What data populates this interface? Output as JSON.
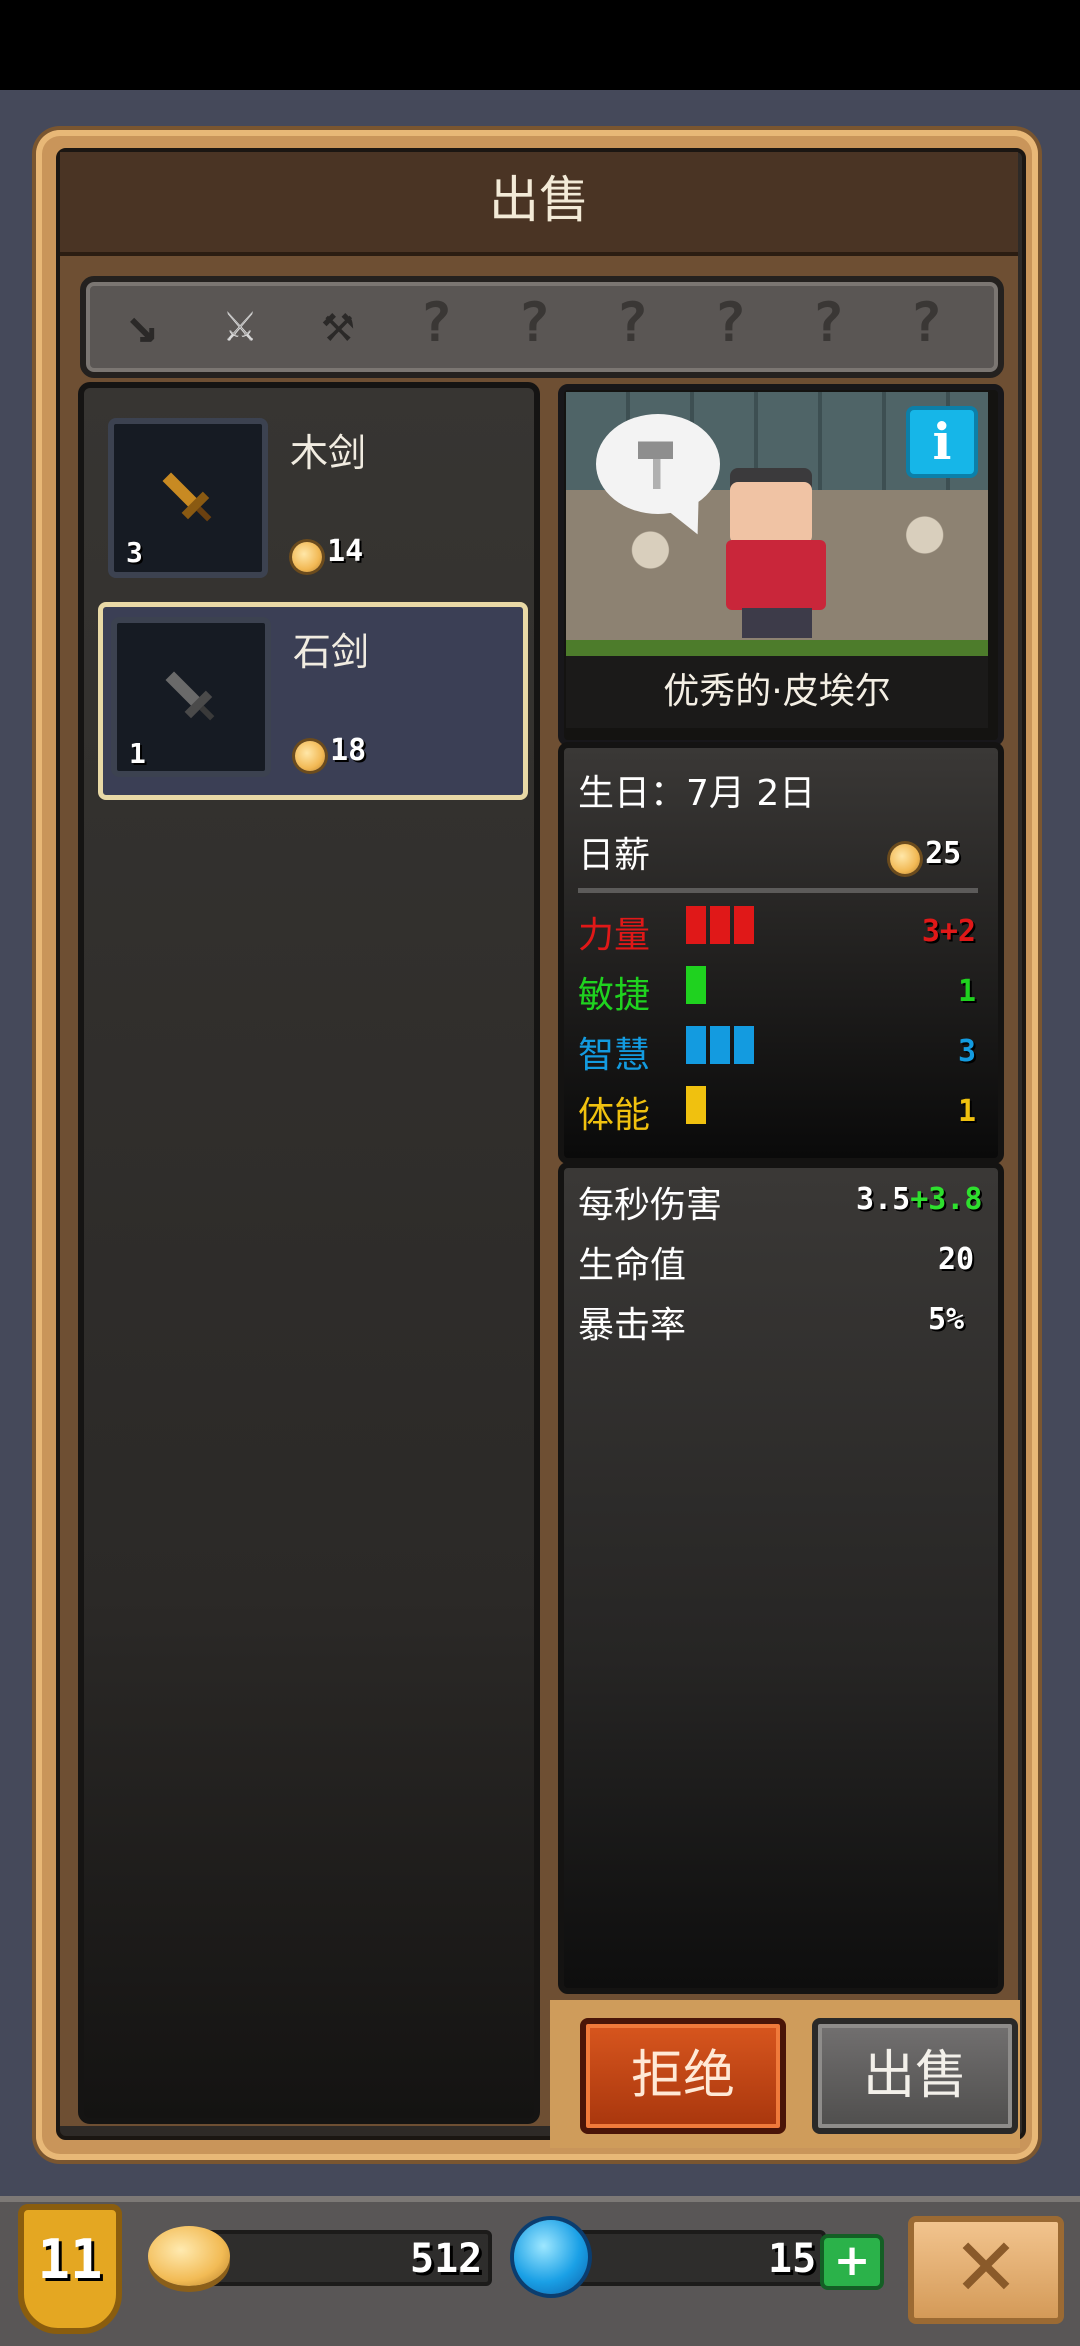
{
  "title": "出售",
  "filter_tabs": [
    {
      "icon": "dagger-icon",
      "glyph": "↘",
      "locked": false
    },
    {
      "icon": "sword-icon",
      "glyph": "⚔",
      "locked": false,
      "selected": true
    },
    {
      "icon": "axe-icon",
      "glyph": "⚒",
      "locked": false
    },
    {
      "icon": "locked-icon",
      "glyph": "?",
      "locked": true
    },
    {
      "icon": "locked-icon",
      "glyph": "?",
      "locked": true
    },
    {
      "icon": "locked-icon",
      "glyph": "?",
      "locked": true
    },
    {
      "icon": "locked-icon",
      "glyph": "?",
      "locked": true
    },
    {
      "icon": "locked-icon",
      "glyph": "?",
      "locked": true
    },
    {
      "icon": "locked-icon",
      "glyph": "?",
      "locked": true
    }
  ],
  "items": [
    {
      "name": "木剑",
      "count": "3",
      "price": "14",
      "icon": "wooden-sword-icon",
      "color": "#b8801e"
    },
    {
      "name": "石剑",
      "count": "1",
      "price": "18",
      "icon": "stone-sword-icon",
      "color": "#5a5a5a"
    }
  ],
  "customer": {
    "name": "优秀的·皮埃尔",
    "thought_icon": "hammer-icon",
    "birthday_label": "生日：",
    "birthday_value": "7月 2日",
    "salary_label": "日薪",
    "salary_value": "25"
  },
  "attributes": [
    {
      "label": "力量",
      "value": "3+2",
      "bars": 3,
      "color": "#e01818"
    },
    {
      "label": "敏捷",
      "value": "1",
      "bars": 1,
      "color": "#1fd21f"
    },
    {
      "label": "智慧",
      "value": "3",
      "bars": 3,
      "color": "#139be0"
    },
    {
      "label": "体能",
      "value": "1",
      "bars": 1,
      "color": "#f0c10f"
    }
  ],
  "combat": {
    "dps_label": "每秒伤害",
    "dps_base": "3.5",
    "dps_bonus": "+3.8",
    "hp_label": "生命值",
    "hp_value": "20",
    "crit_label": "暴击率",
    "crit_value": "5%"
  },
  "buttons": {
    "reject": "拒绝",
    "sell": "出售"
  },
  "footer": {
    "level": "11",
    "gold": "512",
    "gems": "15",
    "plus": "+",
    "close": "✕"
  }
}
